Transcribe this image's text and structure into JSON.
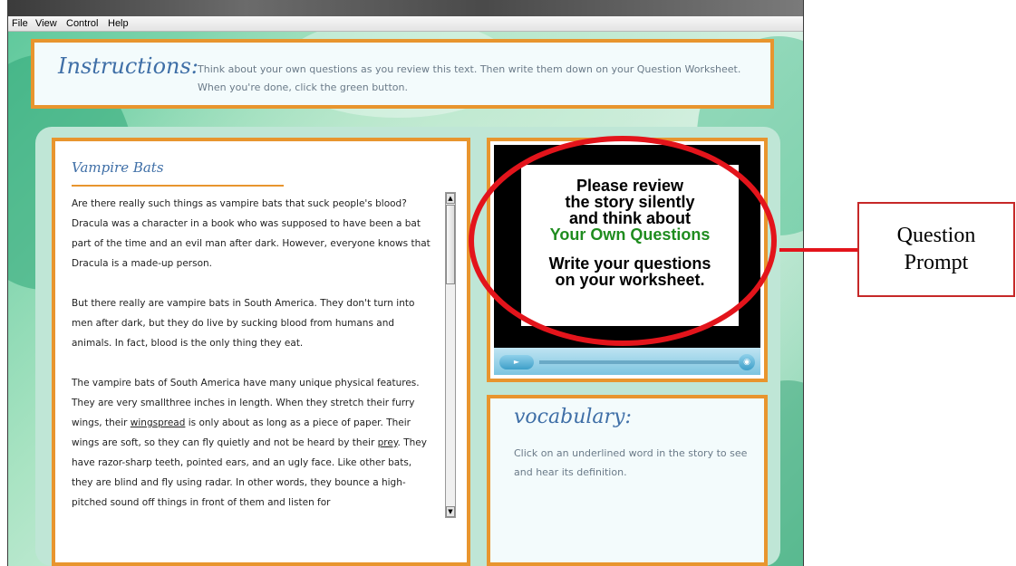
{
  "menu": [
    "File",
    "View",
    "Control",
    "Help"
  ],
  "instructions": {
    "title": "Instructions:",
    "line1": "Think about your own questions as you review this text.  Then write them down on your Question Worksheet.",
    "line2": "When you're done, click the green button."
  },
  "story": {
    "title": "Vampire Bats",
    "p1": "Are there really such things as vampire bats that suck people's blood? Dracula was a character in a book who was supposed to have been a bat part of the time and an evil man after dark.  However, everyone knows that Dracula is a made-up person.",
    "p2": "But there really are vampire bats in South America.  They don't turn into men after dark, but they do live by sucking blood from humans and animals.  In fact, blood is the only thing they eat.",
    "p3a": "The vampire bats of South America have many unique physical features. They are very smallthree inches in length.  When they stretch their furry wings, their ",
    "p3_word1": "wingspread",
    "p3b": " is only about as long as a piece of paper. Their wings are soft, so they can fly quietly and not be heard by their ",
    "p3_word2": "prey",
    "p3c": ".  They have razor-sharp teeth, pointed ears, and an ugly face. Like other bats, they are blind and fly using radar.  In other words, they bounce a high-pitched sound off things in front of them and listen for"
  },
  "video": {
    "card": {
      "l1": "Please review",
      "l2": "the story silently",
      "l3": "and think about",
      "l4": "Your Own Questions",
      "l5": "Write your questions",
      "l6": "on your worksheet."
    },
    "accent_color": "#1f8c1f"
  },
  "vocabulary": {
    "title": "vocabulary:",
    "text": "Click on an underlined word in the story to see and hear its definition."
  },
  "annotation": {
    "label_line1": "Question",
    "label_line2": "Prompt",
    "color": "#e3141b"
  },
  "icons": {
    "play": "play-icon",
    "volume": "volume-icon",
    "scroll_up": "arrow-up-icon",
    "scroll_down": "arrow-down-icon"
  }
}
